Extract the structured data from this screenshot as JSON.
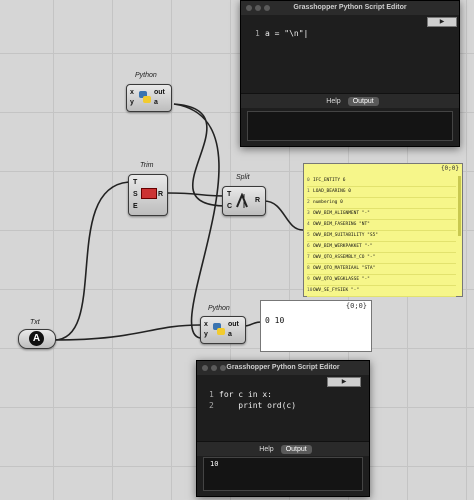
{
  "editor1": {
    "title": "Grasshopper Python Script Editor",
    "run_label": "▶",
    "code": [
      {
        "ln": "1",
        "text": "a = \"\\n\""
      }
    ],
    "tabs": [
      "Help",
      "Output"
    ],
    "output": ""
  },
  "editor2": {
    "title": "Grasshopper Python Script Editor",
    "run_label": "▶",
    "code": [
      {
        "ln": "1",
        "text": "for c in x:"
      },
      {
        "ln": "2",
        "text": "    print ord(c)"
      }
    ],
    "tabs": [
      "Help",
      "Output"
    ],
    "output": "10"
  },
  "components": {
    "python1": {
      "title": "Python",
      "inputs": [
        "x",
        "y"
      ],
      "outputs": [
        "out",
        "a"
      ]
    },
    "trim": {
      "title": "Trim",
      "inputs": [
        "T",
        "S",
        "E"
      ],
      "outputs": [
        "R"
      ]
    },
    "split": {
      "title": "Split",
      "inputs": [
        "T",
        "C"
      ],
      "outputs": [
        "R"
      ]
    },
    "txt": {
      "title": "Txt"
    },
    "python2": {
      "title": "Python",
      "inputs": [
        "x",
        "y"
      ],
      "outputs": [
        "out",
        "a"
      ]
    }
  },
  "panel_list": {
    "header": "{0;0}",
    "rows": [
      {
        "i": "0",
        "t": "IFC_ENTITY 6"
      },
      {
        "i": "1",
        "t": "LOAD_BEARING 0"
      },
      {
        "i": "2",
        "t": "numbering 0"
      },
      {
        "i": "3",
        "t": "OWV_BIM_ALIGNMENT \"-\""
      },
      {
        "i": "4",
        "t": "OWV_BIM_FASERING \"NT\""
      },
      {
        "i": "5",
        "t": "OWV_BIM_SUITABILITY \"S5\""
      },
      {
        "i": "6",
        "t": "OWV_BIM_WERKPAKKET \"-\""
      },
      {
        "i": "7",
        "t": "OWV_QTO_ASSEMBLY_CO \"-\""
      },
      {
        "i": "8",
        "t": "OWV_QTO_MATERIAAL \"STA\""
      },
      {
        "i": "9",
        "t": "OWV_QTO_WEGKLASSE \"-\""
      },
      {
        "i": "10",
        "t": "OWV_SE_FYSIEK \"-\""
      }
    ]
  },
  "panel_out": {
    "header": "{0;0}",
    "value": "0 10"
  }
}
